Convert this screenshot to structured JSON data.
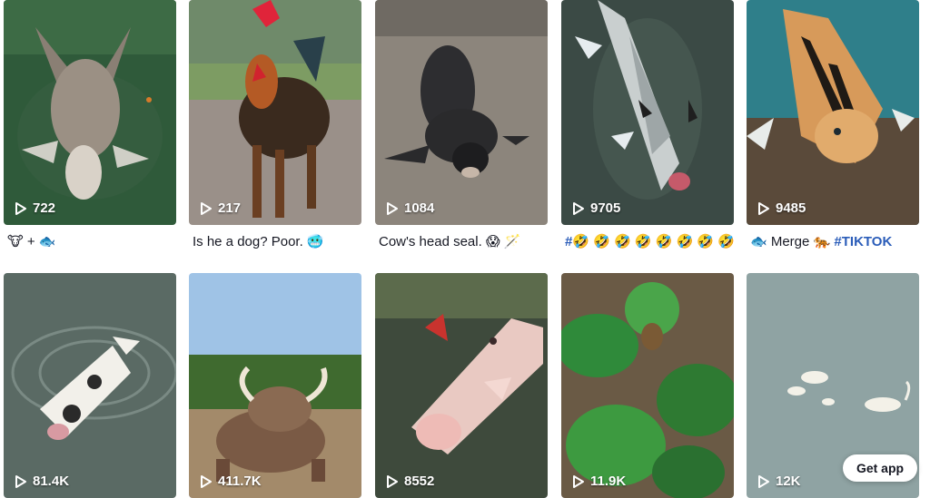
{
  "videos": [
    {
      "views": "722",
      "caption": "🐮 + 🐟"
    },
    {
      "views": "217",
      "caption": "Is he a dog? Poor. 🥶"
    },
    {
      "views": "1084",
      "caption": "Cow's head seal. 😱 🪄"
    },
    {
      "views": "9705",
      "caption_tag": "#",
      "caption": "🤣 🤣 🤣 🤣 🤣 🤣 🤣 🤣"
    },
    {
      "views": "9485",
      "caption": "🐟 Merge 🐅",
      "caption_tag": "#TIKTOK"
    },
    {
      "views": "81.4K"
    },
    {
      "views": "411.7K"
    },
    {
      "views": "8552"
    },
    {
      "views": "11.9K"
    },
    {
      "views": "12K"
    }
  ],
  "get_app_label": "Get app",
  "icons": {
    "play": "play-icon"
  }
}
